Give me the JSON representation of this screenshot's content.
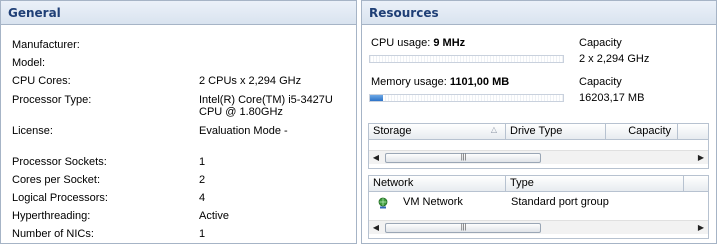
{
  "general": {
    "title": "General",
    "rows": [
      {
        "label": "Manufacturer:",
        "value": ""
      },
      {
        "label": "Model:",
        "value": ""
      },
      {
        "label": "CPU Cores:",
        "value": "2 CPUs x 2,294 GHz"
      },
      {
        "label": "Processor Type:",
        "value": "Intel(R) Core(TM) i5-3427U",
        "value2": "CPU @ 1.80GHz"
      },
      {
        "label": "License:",
        "value": "Evaluation Mode -"
      },
      {
        "label": "Processor Sockets:",
        "value": "1"
      },
      {
        "label": "Cores per Socket:",
        "value": "2"
      },
      {
        "label": "Logical Processors:",
        "value": "4"
      },
      {
        "label": "Hyperthreading:",
        "value": "Active"
      },
      {
        "label": "Number of NICs:",
        "value": "1"
      }
    ]
  },
  "resources": {
    "title": "Resources",
    "cpu": {
      "label": "CPU usage:",
      "value": "9 MHz",
      "capacity_label": "Capacity",
      "capacity": "2 x 2,294 GHz",
      "usage_fraction": 0.0
    },
    "memory": {
      "label": "Memory usage:",
      "value": "1101,00 MB",
      "capacity_label": "Capacity",
      "capacity": "16203,17 MB",
      "usage_fraction": 0.068
    },
    "storage_table": {
      "columns": [
        "Storage",
        "Drive Type",
        "Capacity"
      ]
    },
    "network_table": {
      "columns": [
        "Network",
        "Type"
      ],
      "rows": [
        {
          "network": "VM Network",
          "type": "Standard port group",
          "icon": "network-icon"
        }
      ]
    }
  },
  "colors": {
    "header_text": "#1f3f76",
    "accent": "#2c73c8"
  }
}
